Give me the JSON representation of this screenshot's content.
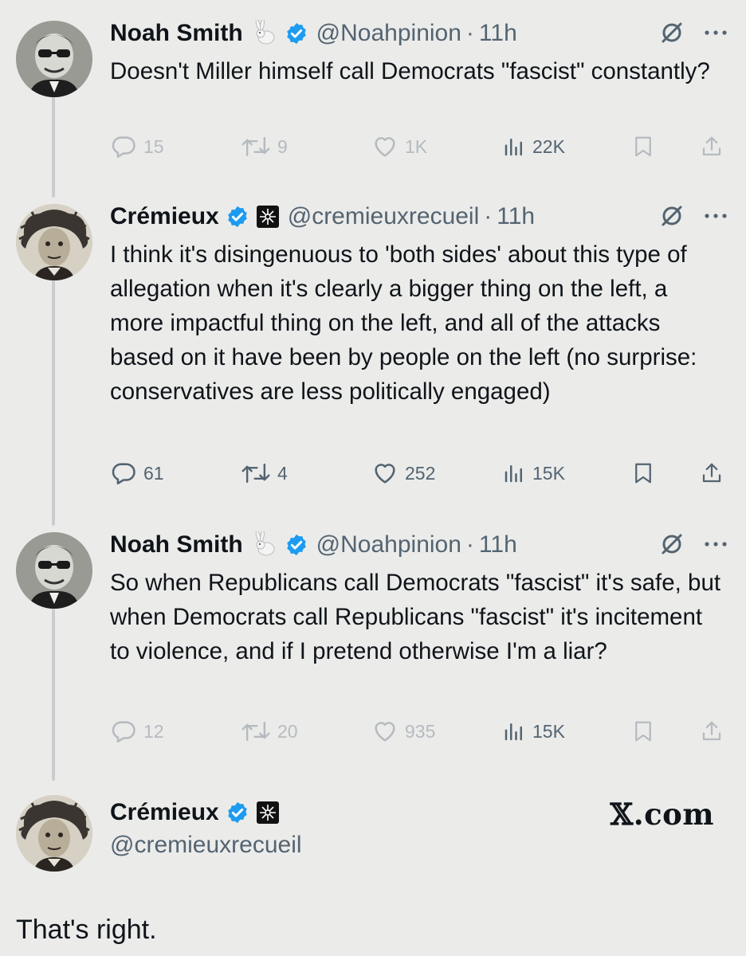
{
  "tweets": [
    {
      "name": "Noah Smith",
      "handle": "@Noahpinion",
      "sep": "·",
      "time": "11h",
      "text": "Doesn't Miller himself call Democrats \"fascist\" constantly?",
      "replies": "15",
      "retweets": "9",
      "likes": "1K",
      "views": "22K"
    },
    {
      "name": "Crémieux",
      "handle": "@cremieuxrecueil",
      "sep": "·",
      "time": "11h",
      "text": "I think it's disingenuous to 'both sides' about this type of allegation when it's clearly a bigger thing on the left, a more impactful thing on the left, and all of the attacks based on it have been by people on the left (no surprise: conservatives are less politically engaged)",
      "replies": "61",
      "retweets": "4",
      "likes": "252",
      "views": "15K"
    },
    {
      "name": "Noah Smith",
      "handle": "@Noahpinion",
      "sep": "·",
      "time": "11h",
      "text": "So when Republicans call Democrats \"fascist\" it's safe, but when Democrats call Republicans \"fascist\" it's incitement to violence, and if I pretend otherwise I'm a liar?",
      "replies": "12",
      "retweets": "20",
      "likes": "935",
      "views": "15K"
    }
  ],
  "final": {
    "name": "Crémieux",
    "handle": "@cremieuxrecueil",
    "brand": "𝕏.com",
    "text": "That's right."
  },
  "colors": {
    "background": "#ebebea",
    "verified_blue": "#1d9bf0",
    "secondary_text": "#536471"
  },
  "icons": [
    "reply-icon",
    "retweet-icon",
    "like-icon",
    "views-icon",
    "bookmark-icon",
    "share-icon",
    "grok-icon",
    "more-icon",
    "verified-badge-icon",
    "rabbit-emoji-icon",
    "affiliate-badge-icon"
  ]
}
